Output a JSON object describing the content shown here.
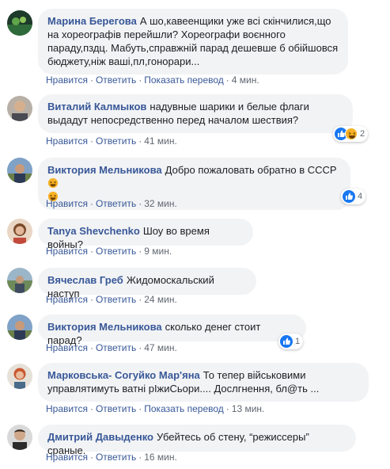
{
  "actions": {
    "like": "Нравится",
    "reply": "Ответить",
    "translate": "Показать перевод",
    "sep": "·"
  },
  "comments": [
    {
      "author": "Марина Берегова",
      "text": "А шо,кавеенщики уже всі скінчилися,що на хореографів перейшли? Хореографи воєнного параду,пздц. Мабуть,справжній парад дешевше б обійшовся бюджету,ніж ваші,пл,гонорари...",
      "time": "4 мин.",
      "has_translate": true
    },
    {
      "author": "Виталий Калмыков",
      "text": "надувные шарики и белые флаги выдадут непосредственно перед началом шествия?",
      "time": "41 мин.",
      "reactions": [
        "like",
        "haha"
      ],
      "reaction_count": "2"
    },
    {
      "author": "Виктория Мельникова",
      "text": "Добро пожаловать обратно в СССР",
      "text_emoji": "rolling-on-floor-laughing-emoji",
      "time": "32 мин.",
      "reactions": [
        "like"
      ],
      "reaction_count": "4"
    },
    {
      "author": "Tanya Shevchenko",
      "text": "Шоу во время войны?",
      "time": "9 мин."
    },
    {
      "author": "Вячеслав Греб",
      "text": "Жидомоскальский наступ",
      "time": "24 мин."
    },
    {
      "author": "Виктория Мельникова",
      "text": "сколько денег стоит парад?",
      "time": "47 мин.",
      "reactions": [
        "like"
      ],
      "reaction_count": "1"
    },
    {
      "author": "Марковська- Согуйко Мар'яна",
      "text": "То тепер військовими управлятимуть ватні рІжиСьори.... Дослгнення, бл@ть ...",
      "time": "13 мин.",
      "has_translate": true
    },
    {
      "author": "Дмитрий Давыденко",
      "text": "Убейтесь об стену, “режиссеры” сраные.",
      "time": "16 мин."
    }
  ],
  "colors": {
    "author": "#385898",
    "bubble": "#f2f3f5",
    "meta": "#606770",
    "like": "#1877f2",
    "haha": "#f7b125"
  }
}
